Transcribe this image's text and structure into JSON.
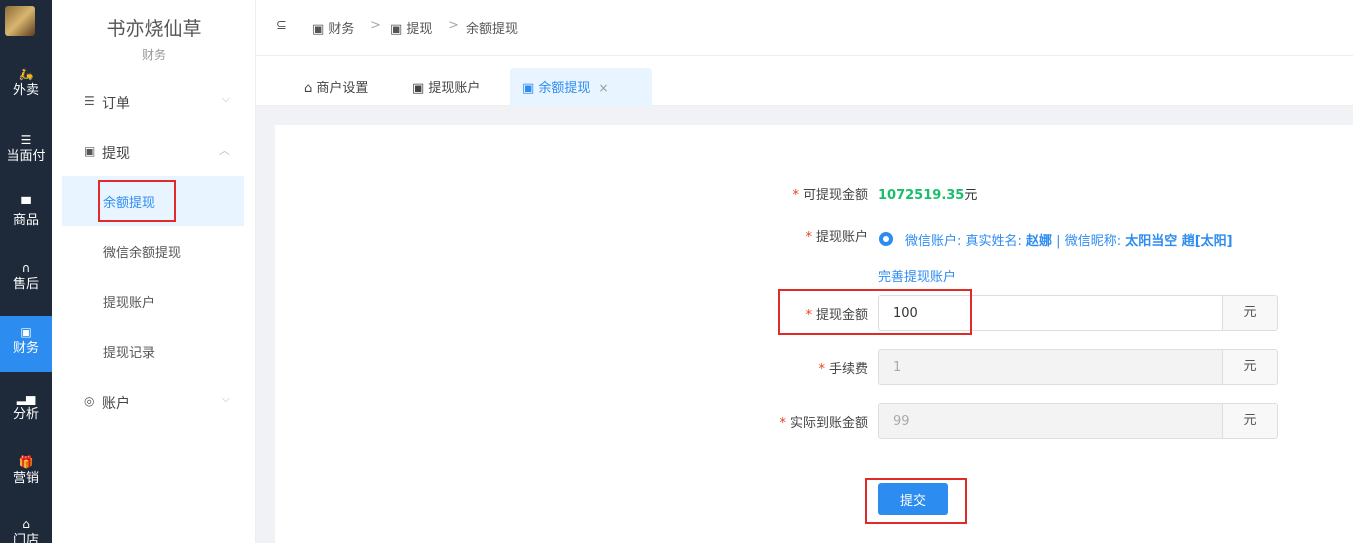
{
  "rail": {
    "items": [
      {
        "label": "外卖",
        "icon": "delivery-icon"
      },
      {
        "label": "当面付",
        "icon": "list-icon"
      },
      {
        "label": "商品",
        "icon": "product-icon"
      },
      {
        "label": "售后",
        "icon": "headset-icon"
      },
      {
        "label": "财务",
        "icon": "finance-icon",
        "active": true
      },
      {
        "label": "分析",
        "icon": "chart-icon"
      },
      {
        "label": "营销",
        "icon": "gift-icon"
      },
      {
        "label": "门店",
        "icon": "store-icon"
      }
    ]
  },
  "sidebar": {
    "title": "书亦烧仙草",
    "subtitle": "财务",
    "groups": {
      "orders": {
        "label": "订单",
        "arrow": "⌵"
      },
      "withdraw": {
        "label": "提现",
        "arrow": "︿"
      },
      "account": {
        "label": "账户",
        "arrow": "⌵"
      }
    },
    "items": {
      "balance": "余额提现",
      "wechat": "微信余额提现",
      "accounts": "提现账户",
      "records": "提现记录"
    }
  },
  "breadcrumb": {
    "collapse_icon": "⊆",
    "items": [
      "财务",
      "提现",
      "余额提现"
    ],
    "sep": ">"
  },
  "tabs": {
    "merchant": "商户设置",
    "accounts": "提现账户",
    "balance": "余额提现",
    "close": "×"
  },
  "form": {
    "balance_label": "可提现金额",
    "balance_value": "1072519.35",
    "balance_unit": "元",
    "account_label": "提现账户",
    "account_prefix": "微信账户: 真实姓名: ",
    "account_name": "赵娜",
    "account_mid": " | 微信昵称: ",
    "account_nick": "太阳当空 趙[太阳]",
    "complete_link": "完善提现账户",
    "amount_label": "提现金额",
    "amount_value": "100",
    "fee_label": "手续费",
    "fee_value": "1",
    "actual_label": "实际到账金额",
    "actual_value": "99",
    "unit": "元",
    "required_mark": "*",
    "submit": "提交"
  },
  "colors": {
    "accent": "#2d8cf0",
    "success": "#19be6b",
    "required": "#ed4014",
    "highlight": "#e02b2b"
  }
}
